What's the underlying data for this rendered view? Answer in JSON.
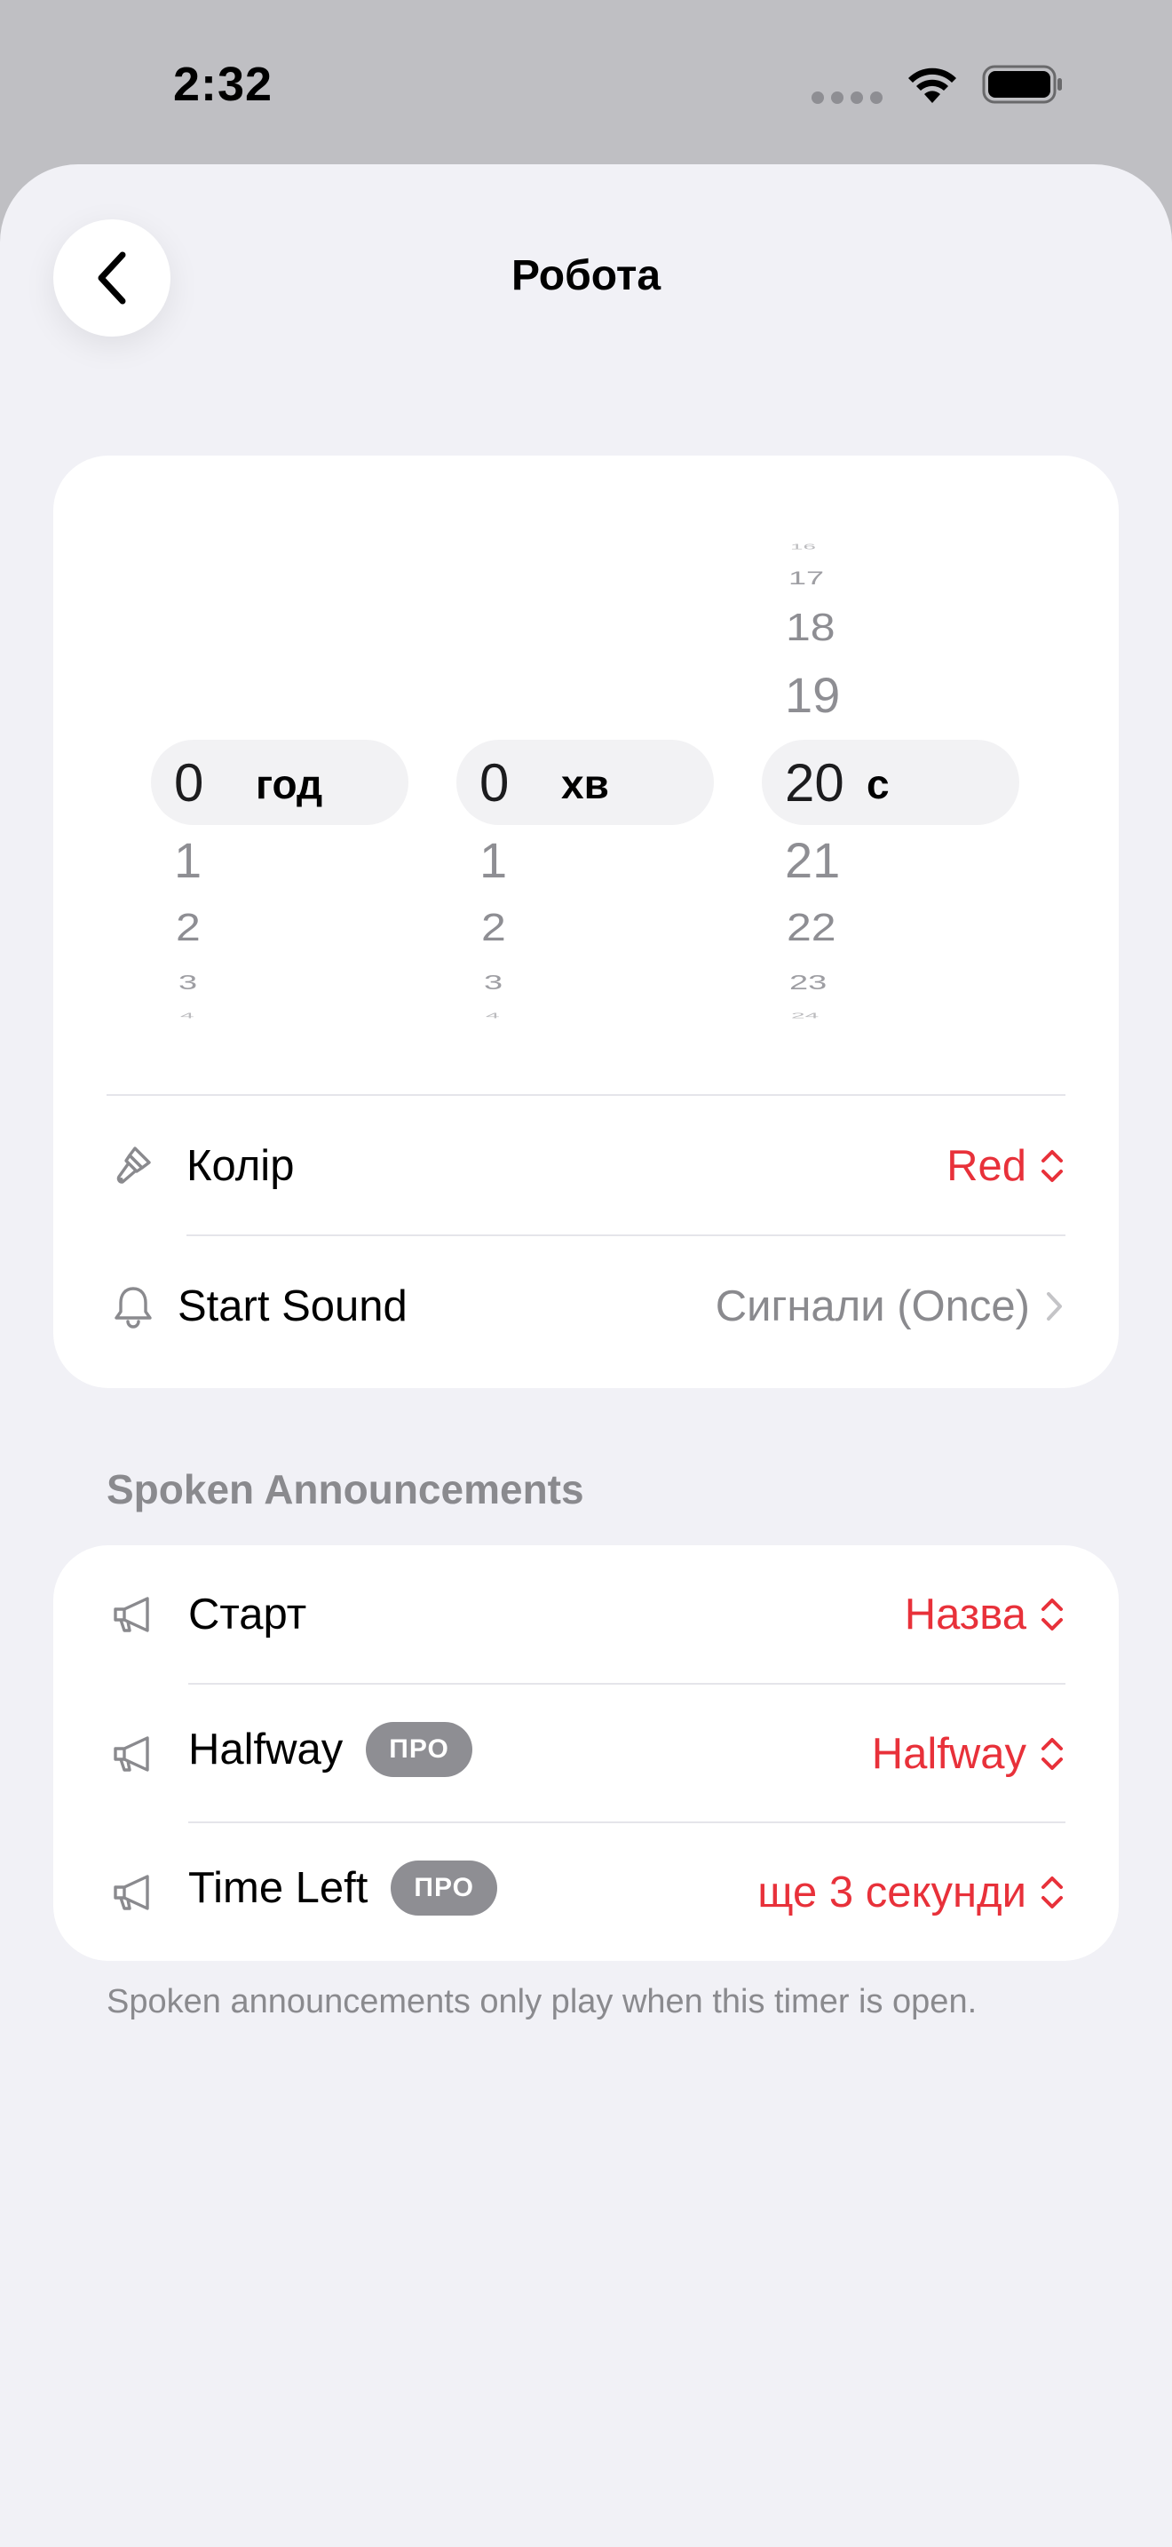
{
  "status": {
    "time": "2:32"
  },
  "nav": {
    "title": "Робота"
  },
  "picker": {
    "hours": {
      "value": "0",
      "unit": "год",
      "below": [
        "1",
        "2",
        "3",
        "4"
      ]
    },
    "minutes": {
      "value": "0",
      "unit": "хв",
      "below": [
        "1",
        "2",
        "3",
        "4"
      ]
    },
    "seconds": {
      "value": "20",
      "unit": "с",
      "above": [
        "16",
        "17",
        "18",
        "19"
      ],
      "below": [
        "21",
        "22",
        "23",
        "24"
      ]
    }
  },
  "settings": {
    "color": {
      "label": "Колір",
      "value": "Red"
    },
    "sound": {
      "label": "Start Sound",
      "value": "Сигнали (Once)"
    }
  },
  "spoken": {
    "header": "Spoken Announcements",
    "rows": [
      {
        "label": "Старт",
        "badge": "",
        "value": "Назва"
      },
      {
        "label": "Halfway",
        "badge": "ПРО",
        "value": "Halfway"
      },
      {
        "label": "Time Left",
        "badge": "ПРО",
        "value": "ще 3 секунди"
      }
    ],
    "footnote": "Spoken announcements only play when this timer is open."
  },
  "colors": {
    "accent": "#e8313a",
    "background": "#f1f1f6",
    "card": "#ffffff",
    "secondary": "#8a8a8e"
  }
}
